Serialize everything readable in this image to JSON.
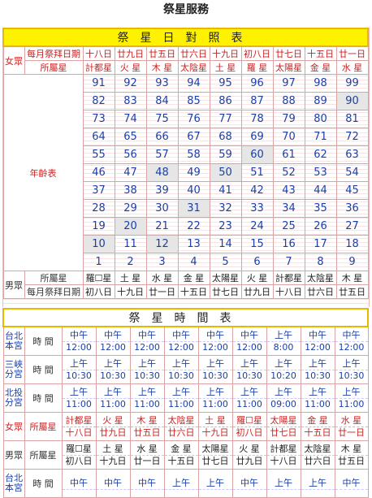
{
  "page_title": "祭星服務",
  "table1": {
    "banner": "祭星日對照表",
    "female_label": "女眾",
    "monthly_label": "每月祭拜日期",
    "belong_label": "所屬星",
    "age_label": "年齡表",
    "male_label": "男眾",
    "female_dates": [
      "十八日",
      "廿九日",
      "廿五日",
      "廿六日",
      "十九日",
      "初八日",
      "廿七日",
      "十五日",
      "廿一日"
    ],
    "female_stars": [
      "計都星",
      "火 星",
      "木 星",
      "太陰星",
      "土 星",
      "羅 星",
      "太陽星",
      "金 星",
      "水 星"
    ],
    "ages": [
      [
        "91",
        "92",
        "93",
        "94",
        "95",
        "96",
        "97",
        "98",
        "99"
      ],
      [
        "82",
        "83",
        "84",
        "85",
        "86",
        "87",
        "88",
        "89",
        "90"
      ],
      [
        "73",
        "74",
        "75",
        "76",
        "77",
        "78",
        "79",
        "80",
        "81"
      ],
      [
        "64",
        "65",
        "66",
        "67",
        "68",
        "69",
        "70",
        "71",
        "72"
      ],
      [
        "55",
        "56",
        "57",
        "58",
        "59",
        "60",
        "61",
        "62",
        "63"
      ],
      [
        "46",
        "47",
        "48",
        "49",
        "50",
        "51",
        "52",
        "53",
        "54"
      ],
      [
        "37",
        "38",
        "39",
        "40",
        "41",
        "42",
        "43",
        "44",
        "45"
      ],
      [
        "28",
        "29",
        "30",
        "31",
        "32",
        "33",
        "34",
        "35",
        "36"
      ],
      [
        "19",
        "20",
        "21",
        "22",
        "23",
        "24",
        "25",
        "26",
        "27"
      ],
      [
        "10",
        "11",
        "12",
        "13",
        "14",
        "15",
        "16",
        "17",
        "18"
      ],
      [
        "1",
        "2",
        "3",
        "4",
        "5",
        "6",
        "7",
        "8",
        "9"
      ]
    ],
    "male_stars": [
      "羅☐星",
      "土 星",
      "水 星",
      "金 星",
      "太陽星",
      "火 星",
      "計都星",
      "太陰星",
      "木 星"
    ],
    "male_dates": [
      "初八日",
      "十九日",
      "廿一日",
      "十五日",
      "廿七日",
      "廿九日",
      "十八日",
      "廿六日",
      "廿五日"
    ]
  },
  "table2": {
    "banner": "祭星時間表",
    "time_label": "時 間",
    "rows": [
      {
        "loc": [
          "台北",
          "本宮"
        ],
        "times": [
          [
            "中午",
            "12:00"
          ],
          [
            "中午",
            "12:00"
          ],
          [
            "中午",
            "12:00"
          ],
          [
            "中午",
            "12:00"
          ],
          [
            "中午",
            "12:00"
          ],
          [
            "中午",
            "12:00"
          ],
          [
            "上午",
            "8:00"
          ],
          [
            "中午",
            "12:00"
          ],
          [
            "中午",
            "12:00"
          ]
        ]
      },
      {
        "loc": [
          "三峽",
          "分宮"
        ],
        "times": [
          [
            "上午",
            "10:30"
          ],
          [
            "上午",
            "10:30"
          ],
          [
            "上午",
            "10:30"
          ],
          [
            "上午",
            "10:30"
          ],
          [
            "上午",
            "10:30"
          ],
          [
            "上午",
            "10:30"
          ],
          [
            "上午",
            "10:20"
          ],
          [
            "上午",
            "10:30"
          ],
          [
            "上午",
            "10:30"
          ]
        ]
      },
      {
        "loc": [
          "北投",
          "分宮"
        ],
        "times": [
          [
            "上午",
            "11:00"
          ],
          [
            "上午",
            "11:00"
          ],
          [
            "上午",
            "11:00"
          ],
          [
            "上午",
            "11:00"
          ],
          [
            "上午",
            "11:00"
          ],
          [
            "上午",
            "11:00"
          ],
          [
            "上午",
            "09:00"
          ],
          [
            "上午",
            "11:00"
          ],
          [
            "上午",
            "11:00"
          ]
        ]
      }
    ],
    "female_label": "女眾",
    "belong_label": "所屬星",
    "female_cells": [
      [
        "計都星",
        "十八日"
      ],
      [
        "火 星",
        "廿九日"
      ],
      [
        "木 星",
        "廿五日"
      ],
      [
        "太陰星",
        "廿六日"
      ],
      [
        "土 星",
        "十九日"
      ],
      [
        "羅☐星",
        "初八日"
      ],
      [
        "太陽星",
        "廿七日"
      ],
      [
        "金 星",
        "十五日"
      ],
      [
        "水 星",
        "廿一日"
      ]
    ],
    "male_label": "男眾",
    "male_cells": [
      [
        "羅☐星",
        "初八日"
      ],
      [
        "土 星",
        "十九日"
      ],
      [
        "水 星",
        "廿一日"
      ],
      [
        "金 星",
        "十五日"
      ],
      [
        "太陽星",
        "廿七日"
      ],
      [
        "火 星",
        "廿九日"
      ],
      [
        "計都星",
        "十八日"
      ],
      [
        "太陰星",
        "廿六日"
      ],
      [
        "木 星",
        "廿五日"
      ]
    ],
    "last_row": {
      "loc": [
        "台北",
        "本宮"
      ],
      "times": [
        [
          "中午",
          ""
        ],
        [
          "中午",
          ""
        ],
        [
          "中午",
          ""
        ],
        [
          "上午",
          ""
        ],
        [
          "上午",
          ""
        ],
        [
          "中午",
          ""
        ],
        [
          "上午",
          ""
        ],
        [
          "上午",
          ""
        ],
        [
          "中午",
          ""
        ]
      ]
    }
  }
}
